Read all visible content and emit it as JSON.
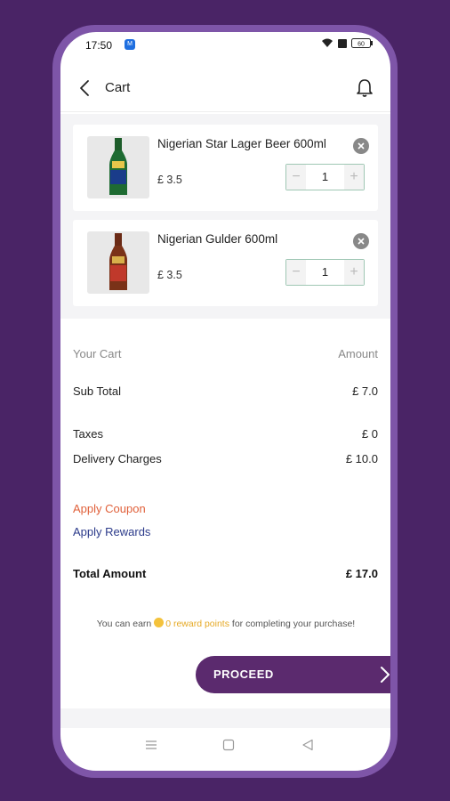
{
  "status_bar": {
    "time": "17:50",
    "notif_badge": "M",
    "battery": "60"
  },
  "header": {
    "title": "Cart"
  },
  "cart_items": [
    {
      "name": "Nigerian Star Lager Beer 600ml",
      "price": "£ 3.5",
      "quantity": "1"
    },
    {
      "name": "Nigerian Gulder 600ml",
      "price": "£ 3.5",
      "quantity": "1"
    }
  ],
  "summary": {
    "header_left": "Your Cart",
    "header_right": "Amount",
    "subtotal_label": "Sub Total",
    "subtotal_value": "£ 7.0",
    "taxes_label": "Taxes",
    "taxes_value": "£ 0",
    "delivery_label": "Delivery Charges",
    "delivery_value": "£ 10.0",
    "coupon_link": "Apply Coupon",
    "rewards_link": "Apply Rewards",
    "total_label": "Total Amount",
    "total_value": "£ 17.0"
  },
  "rewards_note": {
    "prefix": "You can earn",
    "points": "0 reward points",
    "suffix": "for completing your purchase!"
  },
  "proceed_label": "PROCEED",
  "colors": {
    "background": "#4a2466",
    "phone_frame": "#7e55a8",
    "proceed_button": "#5b2a6e",
    "coupon_link": "#e0603a",
    "rewards_link": "#2b3a8a",
    "reward_points": "#e6a925"
  },
  "icons": [
    "back-arrow-icon",
    "bell-icon",
    "remove-icon",
    "minus-icon",
    "plus-icon",
    "chevron-right-icon",
    "wifi-icon",
    "battery-icon",
    "menu-icon",
    "home-square-icon",
    "back-triangle-icon"
  ]
}
